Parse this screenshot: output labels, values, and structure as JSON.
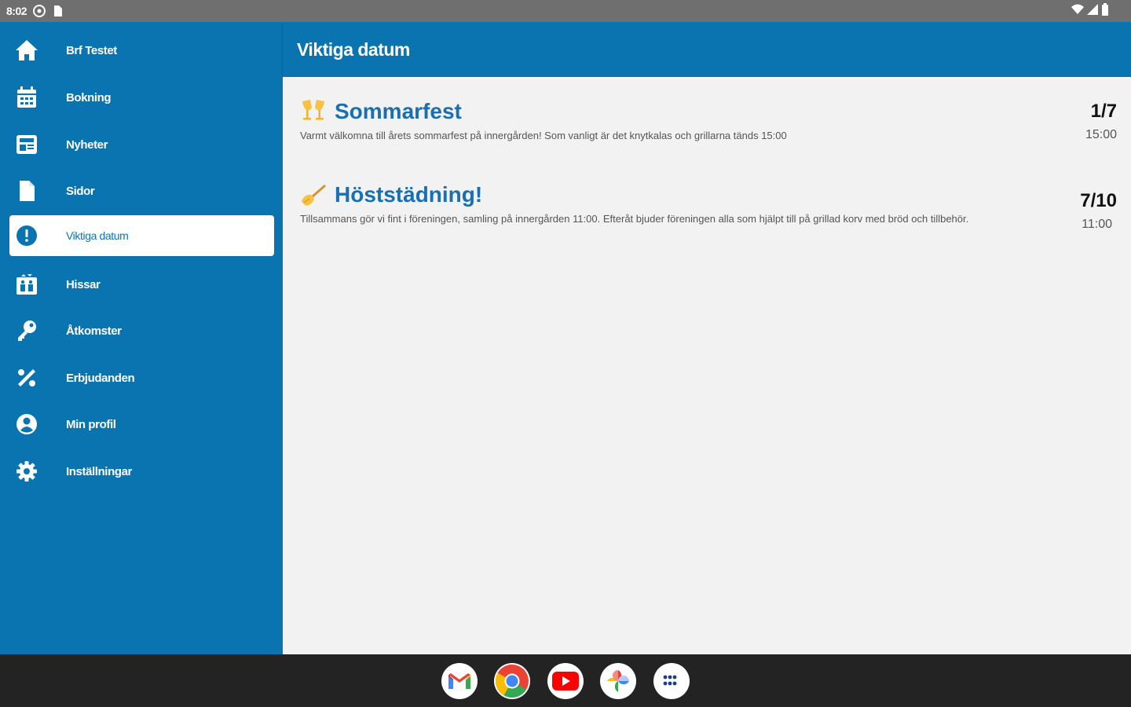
{
  "status_bar": {
    "time": "8:02",
    "icons_left": [
      "settings-status-icon",
      "sim-card-icon"
    ],
    "icons_right": [
      "wifi-icon",
      "signal-icon",
      "battery-icon"
    ]
  },
  "sidebar": {
    "items": [
      {
        "label": "Brf Testet",
        "icon": "home-icon"
      },
      {
        "label": "Bokning",
        "icon": "calendar-icon"
      },
      {
        "label": "Nyheter",
        "icon": "newspaper-icon"
      },
      {
        "label": "Sidor",
        "icon": "page-icon"
      },
      {
        "label": "Viktiga datum",
        "icon": "alert-icon",
        "active": true
      },
      {
        "label": "Hissar",
        "icon": "elevator-icon"
      },
      {
        "label": "Åtkomster",
        "icon": "key-icon"
      },
      {
        "label": "Erbjudanden",
        "icon": "percent-icon"
      },
      {
        "label": "Min profil",
        "icon": "profile-icon"
      },
      {
        "label": "Inställningar",
        "icon": "gear-icon"
      }
    ]
  },
  "header": {
    "title": "Viktiga datum"
  },
  "events": [
    {
      "icon": "cheers-emoji-icon",
      "title": "Sommarfest",
      "description": "Varmt välkomna till årets sommarfest på innergården! Som vanligt är det knytkalas och grillarna tänds 15:00",
      "date": "1/7",
      "time": "15:00"
    },
    {
      "icon": "broom-emoji-icon",
      "title": "Höststädning!",
      "description": "Tillsammans gör vi fint i föreningen, samling på innergården 11:00. Efteråt bjuder föreningen alla som hjälpt till på grillad korv med bröd och tillbehör.",
      "date": "7/10",
      "time": "11:00"
    }
  ],
  "taskbar": {
    "apps": [
      "gmail-icon",
      "chrome-icon",
      "youtube-icon",
      "photos-icon",
      "app-launcher-icon"
    ]
  },
  "colors": {
    "primary": "#0a74b0",
    "title_blue": "#1a6fb0",
    "background": "#f2f2f2",
    "taskbar": "#232323"
  }
}
